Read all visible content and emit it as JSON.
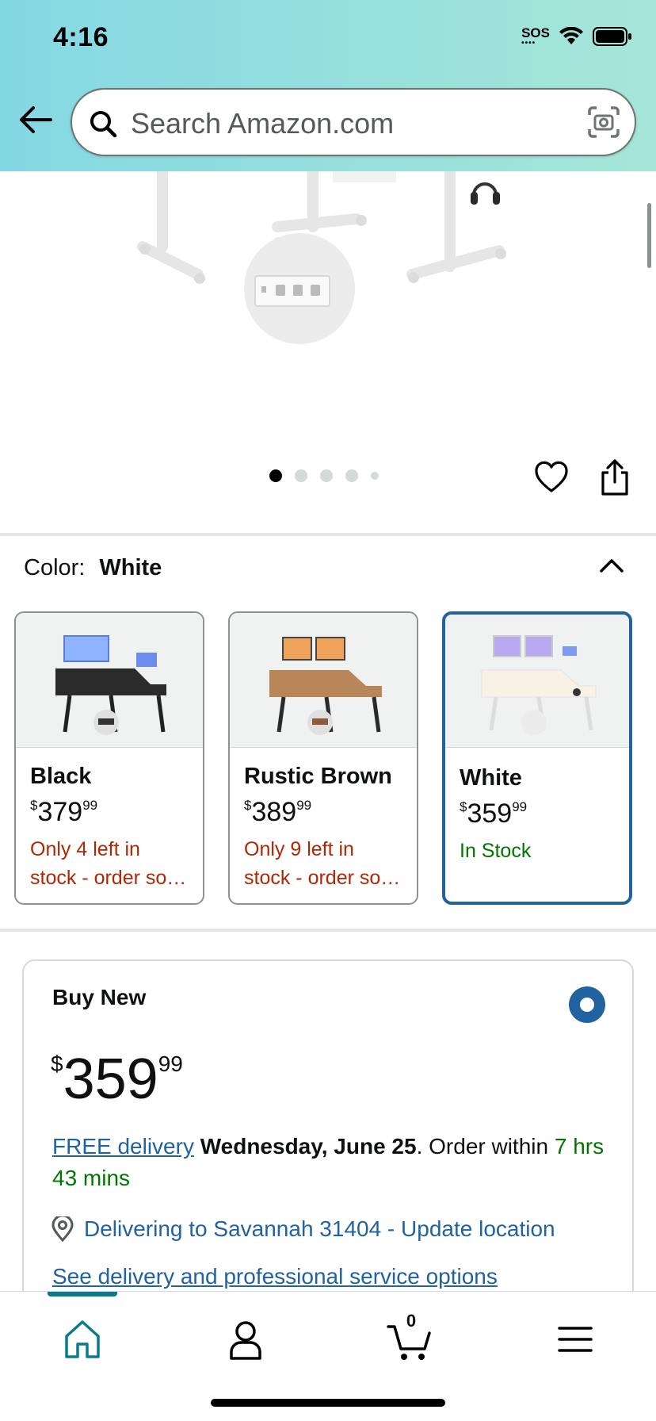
{
  "status_bar": {
    "time": "4:16",
    "sos_label": "SOS"
  },
  "search": {
    "placeholder": "Search Amazon.com"
  },
  "carousel": {
    "dot_count": 5,
    "active_index": 0
  },
  "color_selector": {
    "label": "Color:",
    "selected_value": "White",
    "options": [
      {
        "name": "Black",
        "currency": "$",
        "price_whole": "379",
        "price_fraction": "99",
        "stock_line1": "Only 4 left in",
        "stock_line2": "stock - order soon.",
        "stock_color": "#b12704",
        "selected": false
      },
      {
        "name": "Rustic Brown",
        "currency": "$",
        "price_whole": "389",
        "price_fraction": "99",
        "stock_line1": "Only 9 left in",
        "stock_line2": "stock - order soon.",
        "stock_color": "#b12704",
        "selected": false
      },
      {
        "name": "White",
        "currency": "$",
        "price_whole": "359",
        "price_fraction": "99",
        "stock_line1": "In Stock",
        "stock_line2": "",
        "stock_color": "#007600",
        "selected": true
      }
    ]
  },
  "buy_box": {
    "title": "Buy New",
    "currency": "$",
    "price_whole": "359",
    "price_fraction": "99",
    "delivery_link": "FREE delivery",
    "delivery_date": "Wednesday, June 25",
    "order_within_prefix": ". Order within ",
    "order_within_time": "7 hrs 43 mins",
    "location_text": "Delivering to Savannah 31404 - Update location",
    "see_options": "See delivery and professional service options"
  },
  "tabbar": {
    "cart_count": "0",
    "active_tab": "home"
  },
  "colors": {
    "accent_blue": "#2162a1",
    "deal_red": "#b12704",
    "stock_green": "#007600",
    "header_teal": "#84d8e3"
  }
}
